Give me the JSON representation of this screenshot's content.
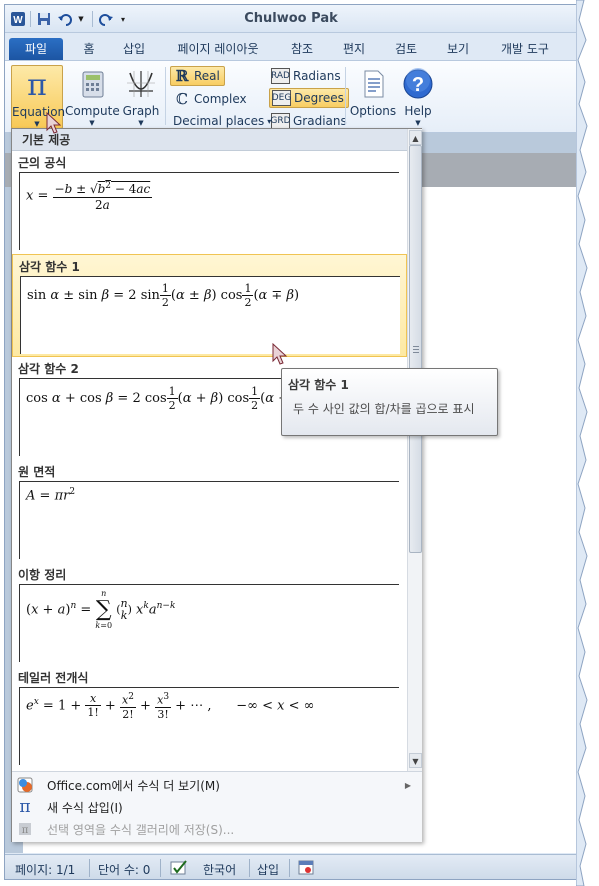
{
  "window": {
    "title": "Chulwoo Pak"
  },
  "quick_access": {
    "app_icon": "word-icon",
    "save_icon": "save-icon",
    "undo_icon": "undo-icon",
    "redo_icon": "redo-icon",
    "customize_icon": "customize-qat-icon"
  },
  "tabs": [
    {
      "label": "파일"
    },
    {
      "label": "홈"
    },
    {
      "label": "삽입"
    },
    {
      "label": "페이지 레이아웃"
    },
    {
      "label": "참조"
    },
    {
      "label": "편지"
    },
    {
      "label": "검토"
    },
    {
      "label": "보기"
    },
    {
      "label": "개발 도구"
    }
  ],
  "ribbon": {
    "equation_label": "Equation",
    "compute_label": "Compute",
    "graph_label": "Graph",
    "real_label": "Real",
    "complex_label": "Complex",
    "decimal_places_label": "Decimal places",
    "radians_label": "Radians",
    "degrees_label": "Degrees",
    "gradians_label": "Gradians",
    "rad_icon_text": "RAD",
    "deg_icon_text": "DEG",
    "grd_icon_text": "GRD",
    "options_label": "Options",
    "help_label": "Help"
  },
  "gallery": {
    "header": "기본 제공",
    "items": [
      {
        "name": "근의 공식",
        "highlighted": false
      },
      {
        "name": "삼각 함수 1",
        "highlighted": true
      },
      {
        "name": "삼각 함수 2",
        "highlighted": false
      },
      {
        "name": "원 면적",
        "highlighted": false
      },
      {
        "name": "이항 정리",
        "highlighted": false
      },
      {
        "name": "테일러 전개식",
        "highlighted": false
      }
    ],
    "footer": [
      {
        "label": "Office.com에서 수식 더 보기(M)",
        "enabled": true
      },
      {
        "label": "새 수식 삽입(I)",
        "enabled": true
      },
      {
        "label": "선택 영역을 수식 갤러리에 저장(S)...",
        "enabled": false
      }
    ]
  },
  "tooltip": {
    "title": "삼각 함수 1",
    "description": "두 수 사인 값의 합/차를 곱으로 표시"
  },
  "status": {
    "page": "페이지: 1/1",
    "words": "단어 수: 0",
    "language": "한국어",
    "mode": "삽입"
  }
}
